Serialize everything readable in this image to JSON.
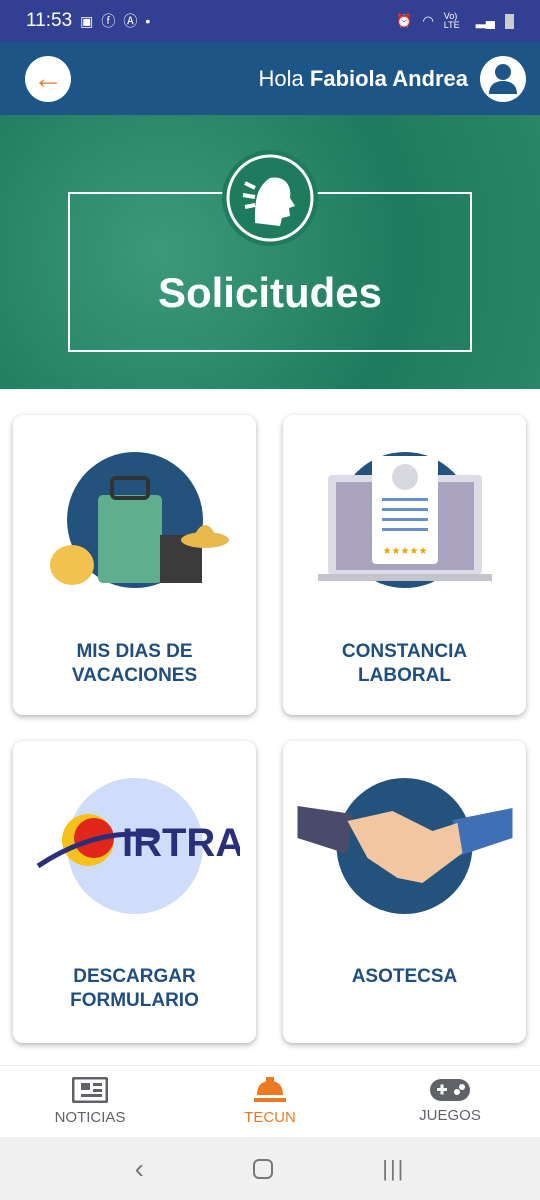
{
  "status_bar": {
    "time": "11:53",
    "network": "Vo) LTE"
  },
  "header": {
    "greeting": "Hola",
    "user_name": "Fabiola Andrea"
  },
  "banner": {
    "title": "Solicitudes"
  },
  "cards": [
    {
      "label_line1": "MIS DIAS DE",
      "label_line2": "VACACIONES"
    },
    {
      "label_line1": "CONSTANCIA",
      "label_line2": "LABORAL"
    },
    {
      "label_line1": "DESCARGAR",
      "label_line2": "FORMULARIO",
      "logo_text": "IRTRA"
    },
    {
      "label_line1": "ASOTECSA",
      "label_line2": ""
    }
  ],
  "bottom_nav": [
    {
      "label": "NOTICIAS",
      "active": false
    },
    {
      "label": "TECUN",
      "active": true
    },
    {
      "label": "JUEGOS",
      "active": false
    }
  ],
  "colors": {
    "header": "#1d5586",
    "status": "#323f93",
    "accent": "#ec7a22",
    "card_text": "#1e4f80",
    "banner": "#1f7b5d"
  }
}
